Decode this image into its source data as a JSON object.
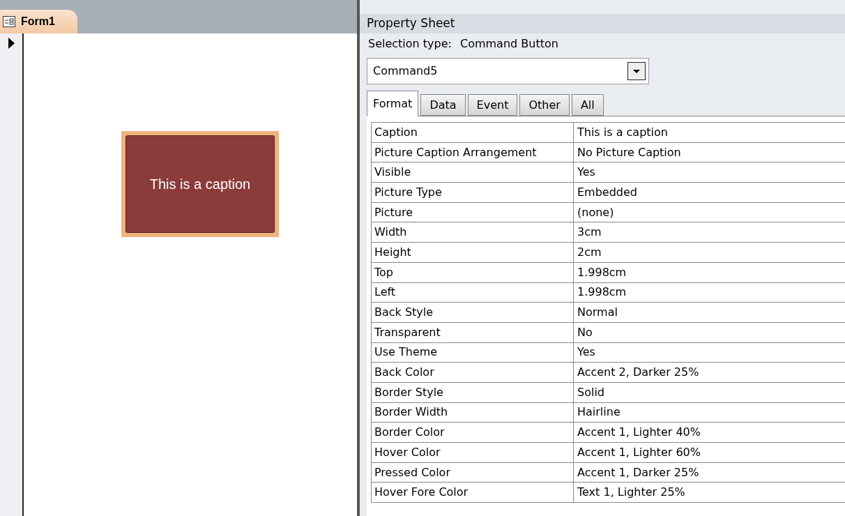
{
  "document_tab": {
    "label": "Form1",
    "selected": true
  },
  "form": {
    "command_button": {
      "caption": "This is a caption"
    }
  },
  "property_sheet": {
    "title": "Property Sheet",
    "selection_type_label": "Selection type:",
    "selection_type": "Command Button",
    "object": "Command5",
    "tabs": [
      {
        "label": "Format",
        "selected": true
      },
      {
        "label": "Data",
        "selected": false
      },
      {
        "label": "Event",
        "selected": false
      },
      {
        "label": "Other",
        "selected": false
      },
      {
        "label": "All",
        "selected": false
      }
    ],
    "properties": [
      {
        "name": "Caption",
        "value": "This is a caption"
      },
      {
        "name": "Picture Caption Arrangement",
        "value": "No Picture Caption"
      },
      {
        "name": "Visible",
        "value": "Yes"
      },
      {
        "name": "Picture Type",
        "value": "Embedded"
      },
      {
        "name": "Picture",
        "value": "(none)"
      },
      {
        "name": "Width",
        "value": "3cm"
      },
      {
        "name": "Height",
        "value": "2cm"
      },
      {
        "name": "Top",
        "value": "1.998cm"
      },
      {
        "name": "Left",
        "value": "1.998cm"
      },
      {
        "name": "Back Style",
        "value": "Normal"
      },
      {
        "name": "Transparent",
        "value": "No"
      },
      {
        "name": "Use Theme",
        "value": "Yes"
      },
      {
        "name": "Back Color",
        "value": "Accent 2, Darker 25%"
      },
      {
        "name": "Border Style",
        "value": "Solid"
      },
      {
        "name": "Border Width",
        "value": "Hairline"
      },
      {
        "name": "Border Color",
        "value": "Accent 1, Lighter 40%"
      },
      {
        "name": "Hover Color",
        "value": "Accent 1, Lighter 60%"
      },
      {
        "name": "Pressed Color",
        "value": "Accent 1, Darker 25%"
      },
      {
        "name": "Hover Fore Color",
        "value": "Text 1, Lighter 25%"
      }
    ]
  }
}
